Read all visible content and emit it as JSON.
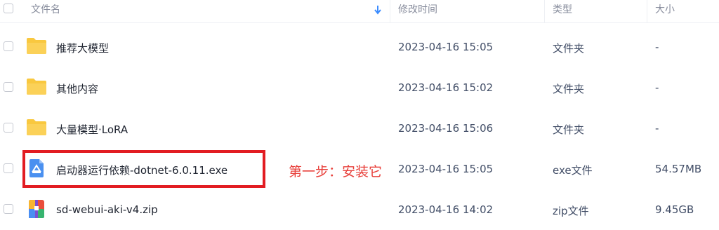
{
  "header": {
    "name": "文件名",
    "modified": "修改时间",
    "type": "类型",
    "size": "大小"
  },
  "rows": [
    {
      "icon": "folder-icon",
      "name": "推荐大模型",
      "modified": "2023-04-16 15:05",
      "type": "文件夹",
      "size": "-"
    },
    {
      "icon": "folder-icon",
      "name": "其他内容",
      "modified": "2023-04-16 15:02",
      "type": "文件夹",
      "size": "-"
    },
    {
      "icon": "folder-icon",
      "name": "大量模型·LoRA",
      "modified": "2023-04-16 15:06",
      "type": "文件夹",
      "size": "-"
    },
    {
      "icon": "exe-file-icon",
      "name": "启动器运行依赖-dotnet-6.0.11.exe",
      "modified": "2023-04-16 15:05",
      "type": "exe文件",
      "size": "54.57MB"
    },
    {
      "icon": "zip-file-icon",
      "name": "sd-webui-aki-v4.zip",
      "modified": "2023-04-16 14:02",
      "type": "zip文件",
      "size": "9.45GB"
    }
  ],
  "annotation": "第一步：安装它",
  "colors": {
    "folder": "#f9c83f",
    "sort_arrow": "#3b8cff",
    "annotation_red": "#e21c22"
  }
}
